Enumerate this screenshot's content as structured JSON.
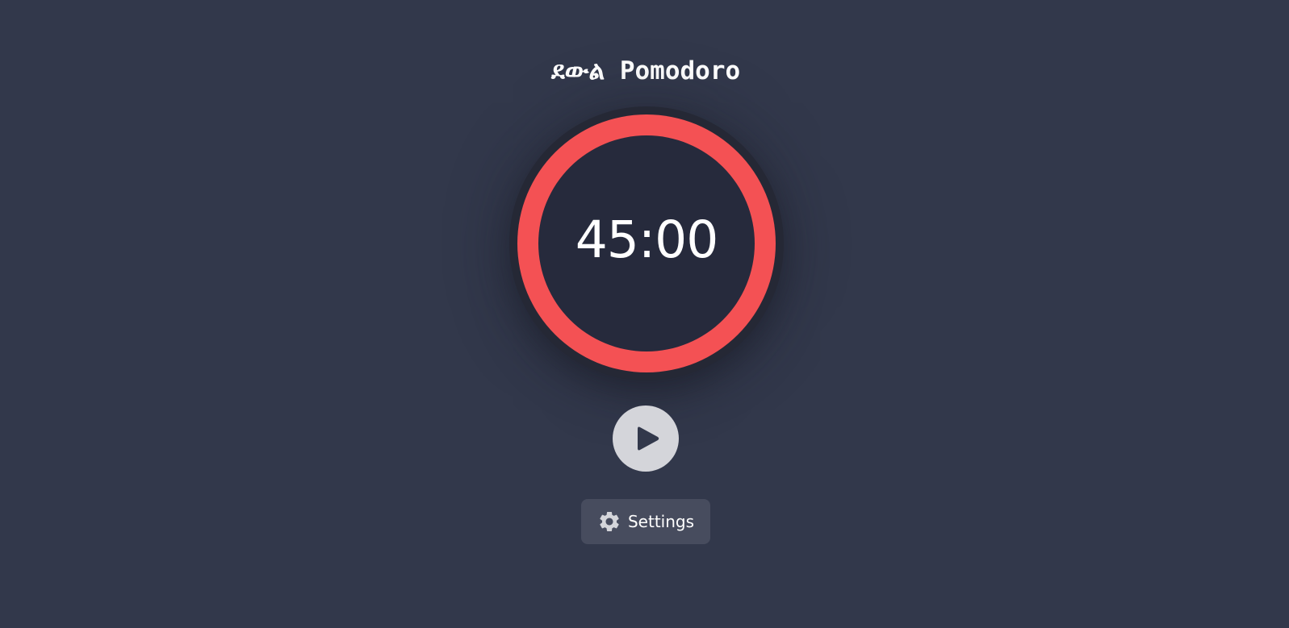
{
  "app": {
    "title": "ደውል Pomodoro"
  },
  "timer": {
    "time": "45:00",
    "progress": 1.0,
    "ring_color": "#f45154",
    "face_color": "#262a3c"
  },
  "controls": {
    "play_icon": "play-icon"
  },
  "settings": {
    "label": "Settings",
    "icon": "gear-icon"
  },
  "colors": {
    "background": "#32384b",
    "accent": "#f45154",
    "button": "#d4d5da"
  }
}
